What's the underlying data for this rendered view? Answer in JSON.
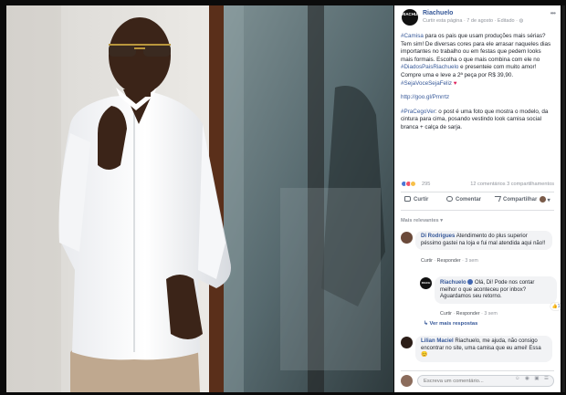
{
  "post": {
    "page_name": "Riachuelo",
    "avatar_text": "RIACHUELO",
    "meta": "Curtir esta página · 7 de agosto · Editado ·",
    "paragraph1": [
      {
        "t": "#Camisa",
        "tag": true
      },
      {
        "t": " para os pais que usam produções mais sérias? Tem sim! De diversas cores para ele arrasar naqueles dias importantes no trabalho ou em festas que pedem looks mais formais. Escolha o que mais combina com ele no ",
        "tag": false
      },
      {
        "t": "#DiadosPaisRiachuelo",
        "tag": true
      },
      {
        "t": " e presenteie com muito amor! Compre uma e leve a 2ª peça por R$ 39,90. ",
        "tag": false
      },
      {
        "t": "#SejaVoceSejaFeliz",
        "tag": true
      },
      {
        "t": " ♥",
        "heart": true
      }
    ],
    "link": "http://goo.gl/Pmrrtz",
    "paragraph3": [
      {
        "t": "#PraCegoVer",
        "tag": true
      },
      {
        "t": ": o post é uma foto que mostra o modelo, da cintura para cima, posando vestindo look camisa social branca + calça de sarja.",
        "tag": false
      }
    ],
    "reaction_count": "295",
    "comment_counts": "12 comentários  3 compartilhamentos"
  },
  "actions": {
    "like": "Curtir",
    "comment": "Comentar",
    "share": "Compartilhar"
  },
  "relevant_label": "Mais relevantes ▾",
  "comments": [
    {
      "author": "Di Rodrigues",
      "text": "Atendimento do plus superior péssimo gastei na loja e fui mal atendida aqui não!!",
      "like": "Curtir",
      "reply": "Responder",
      "time": "3 sem"
    },
    {
      "author": "Riachuelo",
      "text": "Olá, Di! Pode nos contar melhor o que aconteceu por inbox? Aguardamos seu retorno.",
      "like": "Curtir",
      "reply": "Responder",
      "time": "3 sem",
      "likes": "1"
    },
    {
      "author": "Lilian Maciel",
      "text": "Riachuelo, me ajuda, não consigo encontrar no site, uma camisa que eu amei! Essa",
      "emoji": "😊"
    }
  ],
  "more_replies": "Ver mais respostas",
  "write_comment": {
    "placeholder": "Escreva um comentário...",
    "icons": "☺ ◉ ▣ ☰"
  }
}
